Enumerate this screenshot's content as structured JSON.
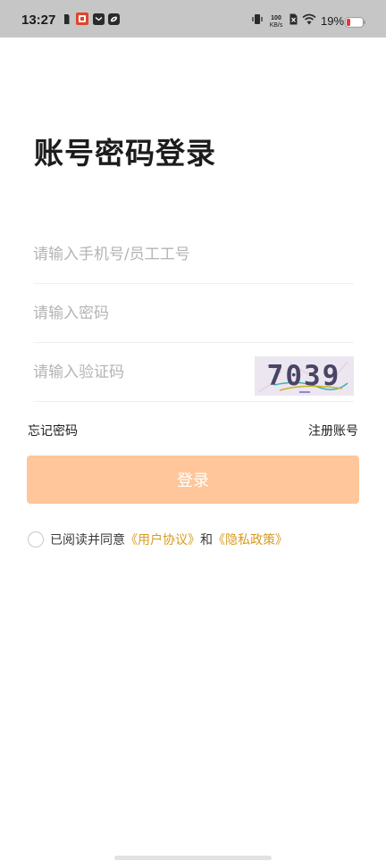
{
  "status_bar": {
    "time": "13:27",
    "net_speed_value": "100",
    "net_speed_unit": "KB/s",
    "battery_percent": "19%"
  },
  "page_title": "账号密码登录",
  "form": {
    "account_placeholder": "请输入手机号/员工工号",
    "password_placeholder": "请输入密码",
    "captcha_placeholder": "请输入验证码",
    "captcha_code": "7039"
  },
  "links": {
    "forgot_password": "忘记密码",
    "register": "注册账号"
  },
  "login_button": "登录",
  "agreement": {
    "prefix": "已阅读并同意",
    "user_agreement": "《用户协议》",
    "and": "和",
    "privacy_policy": "《隐私政策》",
    "checked": false
  },
  "colors": {
    "accent": "#d89a22",
    "button_bg": "#ffc69b",
    "status_bar_bg": "#c6c6c6",
    "battery_low": "#e53935"
  }
}
